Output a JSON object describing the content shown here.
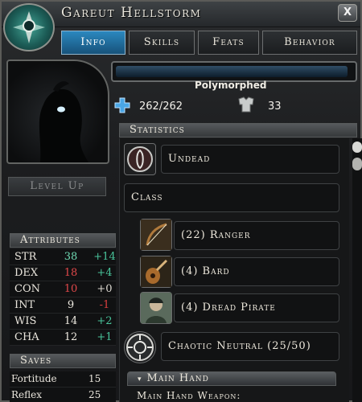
{
  "window": {
    "title": "Gareut Hellstorm",
    "close_label": "X"
  },
  "tabs": [
    {
      "label": "Info",
      "active": true
    },
    {
      "label": "Skills",
      "active": false
    },
    {
      "label": "Feats",
      "active": false
    },
    {
      "label": "Behavior",
      "active": false
    }
  ],
  "left": {
    "level_up_label": "Level Up",
    "attributes_header": "Attributes",
    "attributes": [
      {
        "name": "STR",
        "value": "38",
        "mod": "+14",
        "value_color": "green",
        "mod_color": "green"
      },
      {
        "name": "DEX",
        "value": "18",
        "mod": "+4",
        "value_color": "red",
        "mod_color": "green"
      },
      {
        "name": "CON",
        "value": "10",
        "mod": "+0",
        "value_color": "red",
        "mod_color": "white"
      },
      {
        "name": "INT",
        "value": "9",
        "mod": "-1",
        "value_color": "white",
        "mod_color": "red"
      },
      {
        "name": "WIS",
        "value": "14",
        "mod": "+2",
        "value_color": "white",
        "mod_color": "green"
      },
      {
        "name": "CHA",
        "value": "12",
        "mod": "+1",
        "value_color": "white",
        "mod_color": "green"
      }
    ],
    "saves_header": "Saves",
    "saves": [
      {
        "name": "Fortitude",
        "value": "15"
      },
      {
        "name": "Reflex",
        "value": "25"
      }
    ]
  },
  "status": {
    "bar_fill_fraction": 0.98,
    "state_label": "Polymorphed",
    "hp": "262/262",
    "armor_class": "33"
  },
  "statistics": {
    "header": "Statistics",
    "race": "Undead",
    "class_label": "Class",
    "classes": [
      {
        "label": "(22) Ranger",
        "icon": "bow-icon"
      },
      {
        "label": "(4) Bard",
        "icon": "lute-icon"
      },
      {
        "label": "(4) Dread Pirate",
        "icon": "pirate-portrait-icon"
      }
    ],
    "alignment": "Chaotic Neutral (25/50)",
    "main_hand_header": "Main Hand",
    "main_hand_weapon_label": "Main Hand Weapon:"
  },
  "colors": {
    "active_tab": "#2b88bf",
    "positive": "#49c49b",
    "negative": "#d93f3f",
    "hp_cross": "#4aa6e6"
  }
}
